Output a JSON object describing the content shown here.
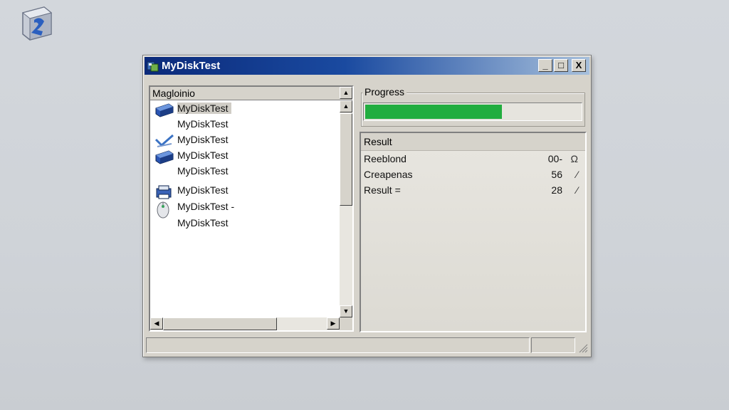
{
  "desktop": {
    "icon_name": "shortcut-drive-icon"
  },
  "window": {
    "title": "MyDiskTest",
    "controls": {
      "minimize": "_",
      "maximize": "□",
      "close": "X"
    }
  },
  "list": {
    "header": "Magloinio",
    "items": [
      {
        "label": "MyDiskTest",
        "icon": "disk-drive-icon",
        "selected": true
      },
      {
        "label": "MyDiskTest",
        "icon": "none",
        "selected": false
      },
      {
        "label": "MyDiskTest",
        "icon": "check-arrow-icon",
        "selected": false
      },
      {
        "label": "MyDiskTest",
        "icon": "disk-drive-icon",
        "selected": false
      },
      {
        "label": "MyDiskTest",
        "icon": "none",
        "selected": false
      },
      {
        "label": "MyDiskTest",
        "icon": "printer-icon",
        "selected": false
      },
      {
        "label": "MyDiskTest -",
        "icon": "mouse-icon",
        "selected": false
      },
      {
        "label": "MyDiskTest",
        "icon": "none",
        "selected": false
      }
    ]
  },
  "progress": {
    "label": "Progress",
    "value_fraction": 0.64,
    "color": "#21ad3f"
  },
  "result": {
    "title": "Result",
    "rows": [
      {
        "key": "Reeblond",
        "value": "00-",
        "mark": "Ω"
      },
      {
        "key": "Creapenas",
        "value": "56",
        "mark": "⁄"
      },
      {
        "key": "Result   =",
        "value": "28",
        "mark": "⁄"
      }
    ]
  }
}
